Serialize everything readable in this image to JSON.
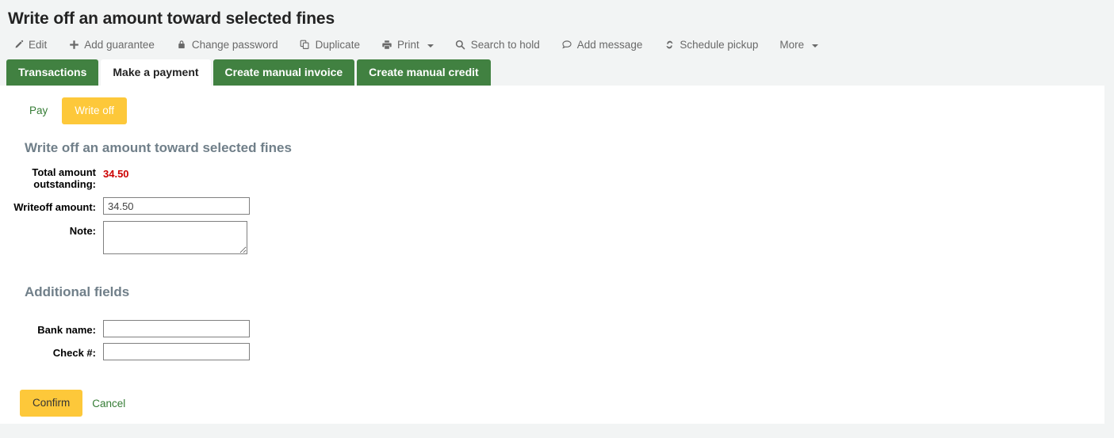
{
  "page": {
    "title": "Write off an amount toward selected fines"
  },
  "toolbar": {
    "items": [
      {
        "label": "Edit",
        "icon": "pencil-icon",
        "caret": false
      },
      {
        "label": "Add guarantee",
        "icon": "plus-icon",
        "caret": false
      },
      {
        "label": "Change password",
        "icon": "lock-icon",
        "caret": false
      },
      {
        "label": "Duplicate",
        "icon": "copy-icon",
        "caret": false
      },
      {
        "label": "Print",
        "icon": "printer-icon",
        "caret": true
      },
      {
        "label": "Search to hold",
        "icon": "search-icon",
        "caret": false
      },
      {
        "label": "Add message",
        "icon": "comment-icon",
        "caret": false
      },
      {
        "label": "Schedule pickup",
        "icon": "refresh-icon",
        "caret": false
      },
      {
        "label": "More",
        "icon": "none",
        "caret": true
      }
    ]
  },
  "tabs": [
    {
      "label": "Transactions",
      "active": false
    },
    {
      "label": "Make a payment",
      "active": true
    },
    {
      "label": "Create manual invoice",
      "active": false
    },
    {
      "label": "Create manual credit",
      "active": false
    }
  ],
  "mode_switch": {
    "pay_label": "Pay",
    "writeoff_label": "Write off"
  },
  "writeoff_section": {
    "heading": "Write off an amount toward selected fines",
    "total_label": "Total amount outstanding:",
    "total_value": "34.50",
    "amount_label": "Writeoff amount:",
    "amount_value": "34.50",
    "amount_placeholder": "",
    "note_label": "Note:",
    "note_value": "",
    "note_placeholder": ""
  },
  "additional_section": {
    "heading": "Additional fields",
    "bank_label": "Bank name:",
    "bank_value": "",
    "bank_placeholder": "",
    "check_label": "Check #:",
    "check_value": "",
    "check_placeholder": ""
  },
  "actions": {
    "confirm_label": "Confirm",
    "cancel_label": "Cancel"
  },
  "colors": {
    "tab_green": "#418141",
    "accent_amber": "#fdc83a",
    "link_green": "#357c35",
    "amount_red": "#cc0000",
    "heading_gray": "#707f89",
    "page_bg": "#f2f4f4"
  }
}
